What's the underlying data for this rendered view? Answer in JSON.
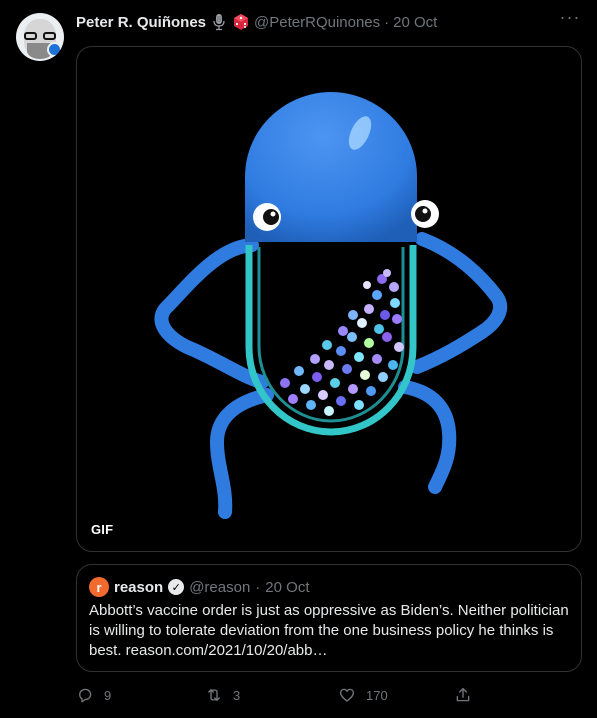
{
  "tweet": {
    "author_name": "Peter R. Quiñones",
    "author_handle": "@PeterRQuinones",
    "separator": "·",
    "date": "20 Oct",
    "more_label": "···",
    "media": {
      "type": "gif",
      "badge": "GIF"
    }
  },
  "quote": {
    "logo_letter": "r",
    "author_name": "reason",
    "verified_mark": "✓",
    "author_handle": "@reason",
    "separator": "·",
    "date": "20 Oct",
    "text": "Abbott’s vaccine order is just as oppressive as Biden’s. Neither politician is willing to tolerate deviation from the one business policy he thinks is best. reason.com/2021/10/20/abb…"
  },
  "actions": {
    "reply_count": "9",
    "retweet_count": "3",
    "like_count": "170"
  },
  "colors": {
    "pill_blue": "#2f7be0",
    "link_accent": "#1d9bf0",
    "muted": "#71767b",
    "border": "#2f3336"
  }
}
